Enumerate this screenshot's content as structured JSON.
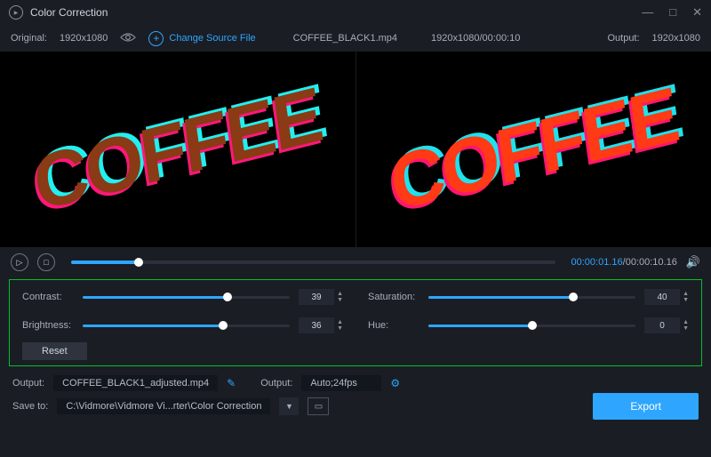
{
  "titlebar": {
    "title": "Color Correction"
  },
  "infobar": {
    "original_label": "Original:",
    "original_res": "1920x1080",
    "change_source_label": "Change Source File",
    "filename": "COFFEE_BLACK1.mp4",
    "res_dur": "1920x1080/00:00:10",
    "output_label": "Output:",
    "output_res": "1920x1080"
  },
  "preview_text": "COFFEE",
  "transport": {
    "current_time": "00:00:01.16",
    "total_time": "/00:00:10.16"
  },
  "controls": {
    "contrast": {
      "label": "Contrast:",
      "value": "39",
      "pct": 70
    },
    "brightness": {
      "label": "Brightness:",
      "value": "36",
      "pct": 68
    },
    "saturation": {
      "label": "Saturation:",
      "value": "40",
      "pct": 70
    },
    "hue": {
      "label": "Hue:",
      "value": "0",
      "pct": 50
    },
    "reset_label": "Reset"
  },
  "output": {
    "label": "Output:",
    "filename": "COFFEE_BLACK1_adjusted.mp4",
    "fmt_label": "Output:",
    "format": "Auto;24fps"
  },
  "save": {
    "label": "Save to:",
    "path": "C:\\Vidmore\\Vidmore Vi...rter\\Color Correction"
  },
  "export_label": "Export"
}
